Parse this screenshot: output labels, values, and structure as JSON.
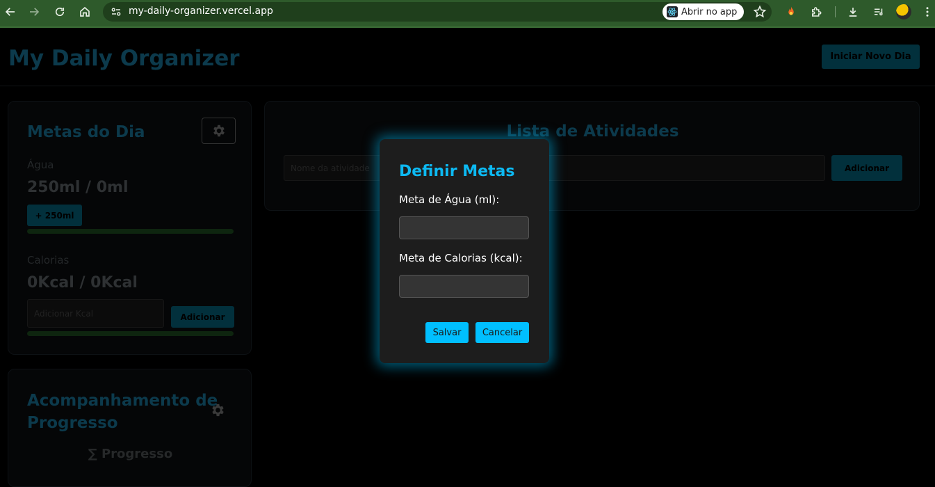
{
  "browser": {
    "url": "my-daily-organizer.vercel.app",
    "open_in_app_label": "Abrir no app"
  },
  "app": {
    "title": "My Daily Organizer",
    "new_day_button": "Iniciar Novo Dia"
  },
  "goals_card": {
    "title": "Metas do Dia",
    "water_label": "Água",
    "water_value": "250ml / 0ml",
    "add_water_button": "+ 250ml",
    "calories_label": "Calorias",
    "calories_value": "0Kcal / 0Kcal",
    "calories_placeholder": "Adicionar Kcal",
    "add_calories_button": "Adicionar"
  },
  "progress_card": {
    "title_line1": "Acompanhamento de",
    "title_line2": "Progresso",
    "subtitle": "∑ Progresso"
  },
  "activities_card": {
    "title": "Lista de Atividades",
    "input_placeholder": "Nome da atividade",
    "add_button": "Adicionar"
  },
  "modal": {
    "title": "Definir Metas",
    "water_label": "Meta de Água (ml):",
    "water_value": "",
    "calories_label": "Meta de Calorias (kcal):",
    "calories_value": "",
    "save_button": "Salvar",
    "cancel_button": "Cancelar"
  },
  "colors": {
    "accent": "#00bfff",
    "modal_title": "#0db9f2",
    "browser_frame": "#2e5a2b"
  }
}
